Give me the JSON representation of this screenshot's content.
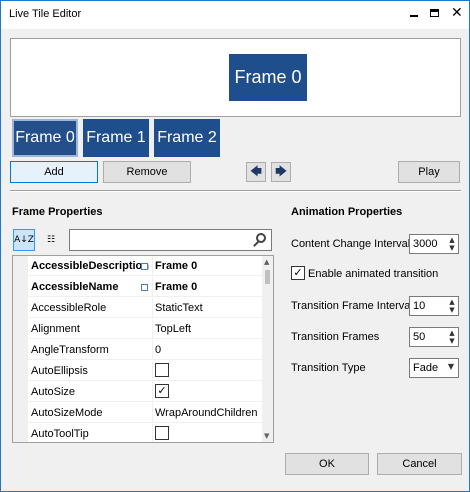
{
  "window": {
    "title": "Live Tile Editor"
  },
  "icons": {
    "minimize": "minimize-icon",
    "maximize": "maximize-icon",
    "close": "close-icon",
    "close_glyph": "✕"
  },
  "preview": {
    "tile_text": "Frame 0"
  },
  "frames": [
    "Frame 0",
    "Frame 1",
    "Frame 2"
  ],
  "buttons": {
    "add": "Add",
    "remove": "Remove",
    "prev_glyph": "🡄",
    "next_glyph": "🡆",
    "play": "Play",
    "ok": "OK",
    "cancel": "Cancel"
  },
  "frame_properties": {
    "title": "Frame Properties",
    "search_placeholder": "",
    "rows": [
      {
        "name": "AccessibleDescription",
        "value": "Frame 0",
        "bold": true,
        "marker": true
      },
      {
        "name": "AccessibleName",
        "value": "Frame 0",
        "bold": true,
        "marker": true
      },
      {
        "name": "AccessibleRole",
        "value": "StaticText"
      },
      {
        "name": "Alignment",
        "value": "TopLeft"
      },
      {
        "name": "AngleTransform",
        "value": "0"
      },
      {
        "name": "AutoEllipsis",
        "value": "",
        "checkbox": true,
        "checked": false
      },
      {
        "name": "AutoSize",
        "value": "",
        "checkbox": true,
        "checked": true
      },
      {
        "name": "AutoSizeMode",
        "value": "WrapAroundChildren"
      },
      {
        "name": "AutoToolTip",
        "value": "",
        "checkbox": true,
        "checked": false
      }
    ]
  },
  "animation_properties": {
    "title": "Animation Properties",
    "content_change_interval_label": "Content Change Interval",
    "content_change_interval_value": "3000",
    "enable_animated_transition_label": "Enable animated transition",
    "enable_animated_transition_checked": true,
    "transition_frame_interval_label": "Transition Frame Interval",
    "transition_frame_interval_value": "10",
    "transition_frames_label": "Transition Frames",
    "transition_frames_value": "50",
    "transition_type_label": "Transition Type",
    "transition_type_value": "Fade"
  },
  "colors": {
    "tile": "#1f4e8c",
    "accent": "#0078d7",
    "window_border": "#1e78d0"
  }
}
